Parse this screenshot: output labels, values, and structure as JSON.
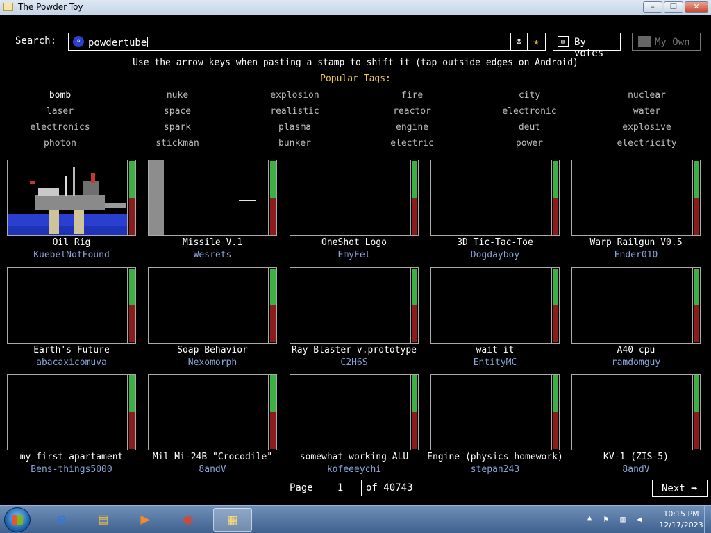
{
  "window": {
    "title": "The Powder Toy",
    "min": "–",
    "max": "❐",
    "close": "✕"
  },
  "search": {
    "label": "Search:",
    "query": "powdertube",
    "icon": "magnifier-icon",
    "clear_glyph": "⊗",
    "fav_glyph": "★"
  },
  "sort": {
    "label": "By votes",
    "glyph": "▤"
  },
  "my_own": {
    "label": "My Own"
  },
  "hint": "Use the arrow keys when pasting a stamp to shift it (tap outside edges on Android)",
  "tags_title": "Popular Tags:",
  "tags": [
    [
      "bomb",
      "nuke",
      "explosion",
      "fire",
      "city",
      "nuclear"
    ],
    [
      "laser",
      "space",
      "realistic",
      "reactor",
      "electronic",
      "water"
    ],
    [
      "electronics",
      "spark",
      "plasma",
      "engine",
      "deut",
      "explosive"
    ],
    [
      "photon",
      "stickman",
      "bunker",
      "electric",
      "power",
      "electricity"
    ]
  ],
  "saves": [
    {
      "name": "Oil Rig",
      "author": "KuebelNotFound",
      "up": 0.5,
      "thumb": "oilrig"
    },
    {
      "name": "Missile V.1",
      "author": "Wesrets",
      "up": 0.5,
      "thumb": "missile"
    },
    {
      "name": "OneShot Logo",
      "author": "EmyFel",
      "up": 0.5,
      "thumb": ""
    },
    {
      "name": "3D Tic-Tac-Toe",
      "author": "Dogdayboy",
      "up": 0.5,
      "thumb": ""
    },
    {
      "name": "Warp Railgun V0.5",
      "author": "Ender010",
      "up": 0.5,
      "thumb": ""
    },
    {
      "name": "Earth's Future",
      "author": "abacaxicomuva",
      "up": 0.5,
      "thumb": ""
    },
    {
      "name": "Soap Behavior",
      "author": "Nexomorph",
      "up": 0.5,
      "thumb": ""
    },
    {
      "name": "Ray Blaster v.prototype",
      "author": "C2H6S",
      "up": 0.5,
      "thumb": ""
    },
    {
      "name": "wait it",
      "author": "EntityMC",
      "up": 0.5,
      "thumb": ""
    },
    {
      "name": "A40 cpu",
      "author": "ramdomguy",
      "up": 0.5,
      "thumb": ""
    },
    {
      "name": "my first apartament",
      "author": "Bens-things5000",
      "up": 0.5,
      "thumb": ""
    },
    {
      "name": "Mil Mi-24B \"Crocodile\"",
      "author": "8andV",
      "up": 0.5,
      "thumb": ""
    },
    {
      "name": "somewhat working ALU",
      "author": "kofeeeychi",
      "up": 0.5,
      "thumb": ""
    },
    {
      "name": "Engine (physics homework)",
      "author": "stepan243",
      "up": 0.5,
      "thumb": ""
    },
    {
      "name": "KV-1 (ZIS-5)",
      "author": "8andV",
      "up": 0.5,
      "thumb": ""
    }
  ],
  "pager": {
    "label": "Page",
    "current": "1",
    "of_label": "of 40743",
    "next": "Next"
  },
  "taskbar": {
    "apps": [
      {
        "name": "internet-explorer",
        "glyph": "e",
        "color": "#2b7be0"
      },
      {
        "name": "file-explorer",
        "glyph": "▤",
        "color": "#e2b84a"
      },
      {
        "name": "media-player",
        "glyph": "▶",
        "color": "#f08a2a"
      },
      {
        "name": "chrome",
        "glyph": "◉",
        "color": "#d9462e"
      },
      {
        "name": "powder-toy",
        "glyph": "▦",
        "color": "#f1d77a"
      }
    ],
    "time": "10:15 PM",
    "date": "12/17/2023"
  },
  "colors": {
    "accent": "#f2c94c",
    "author": "#8aa4d6",
    "vote_up": "#3cb043",
    "vote_down": "#8c1b1b"
  }
}
